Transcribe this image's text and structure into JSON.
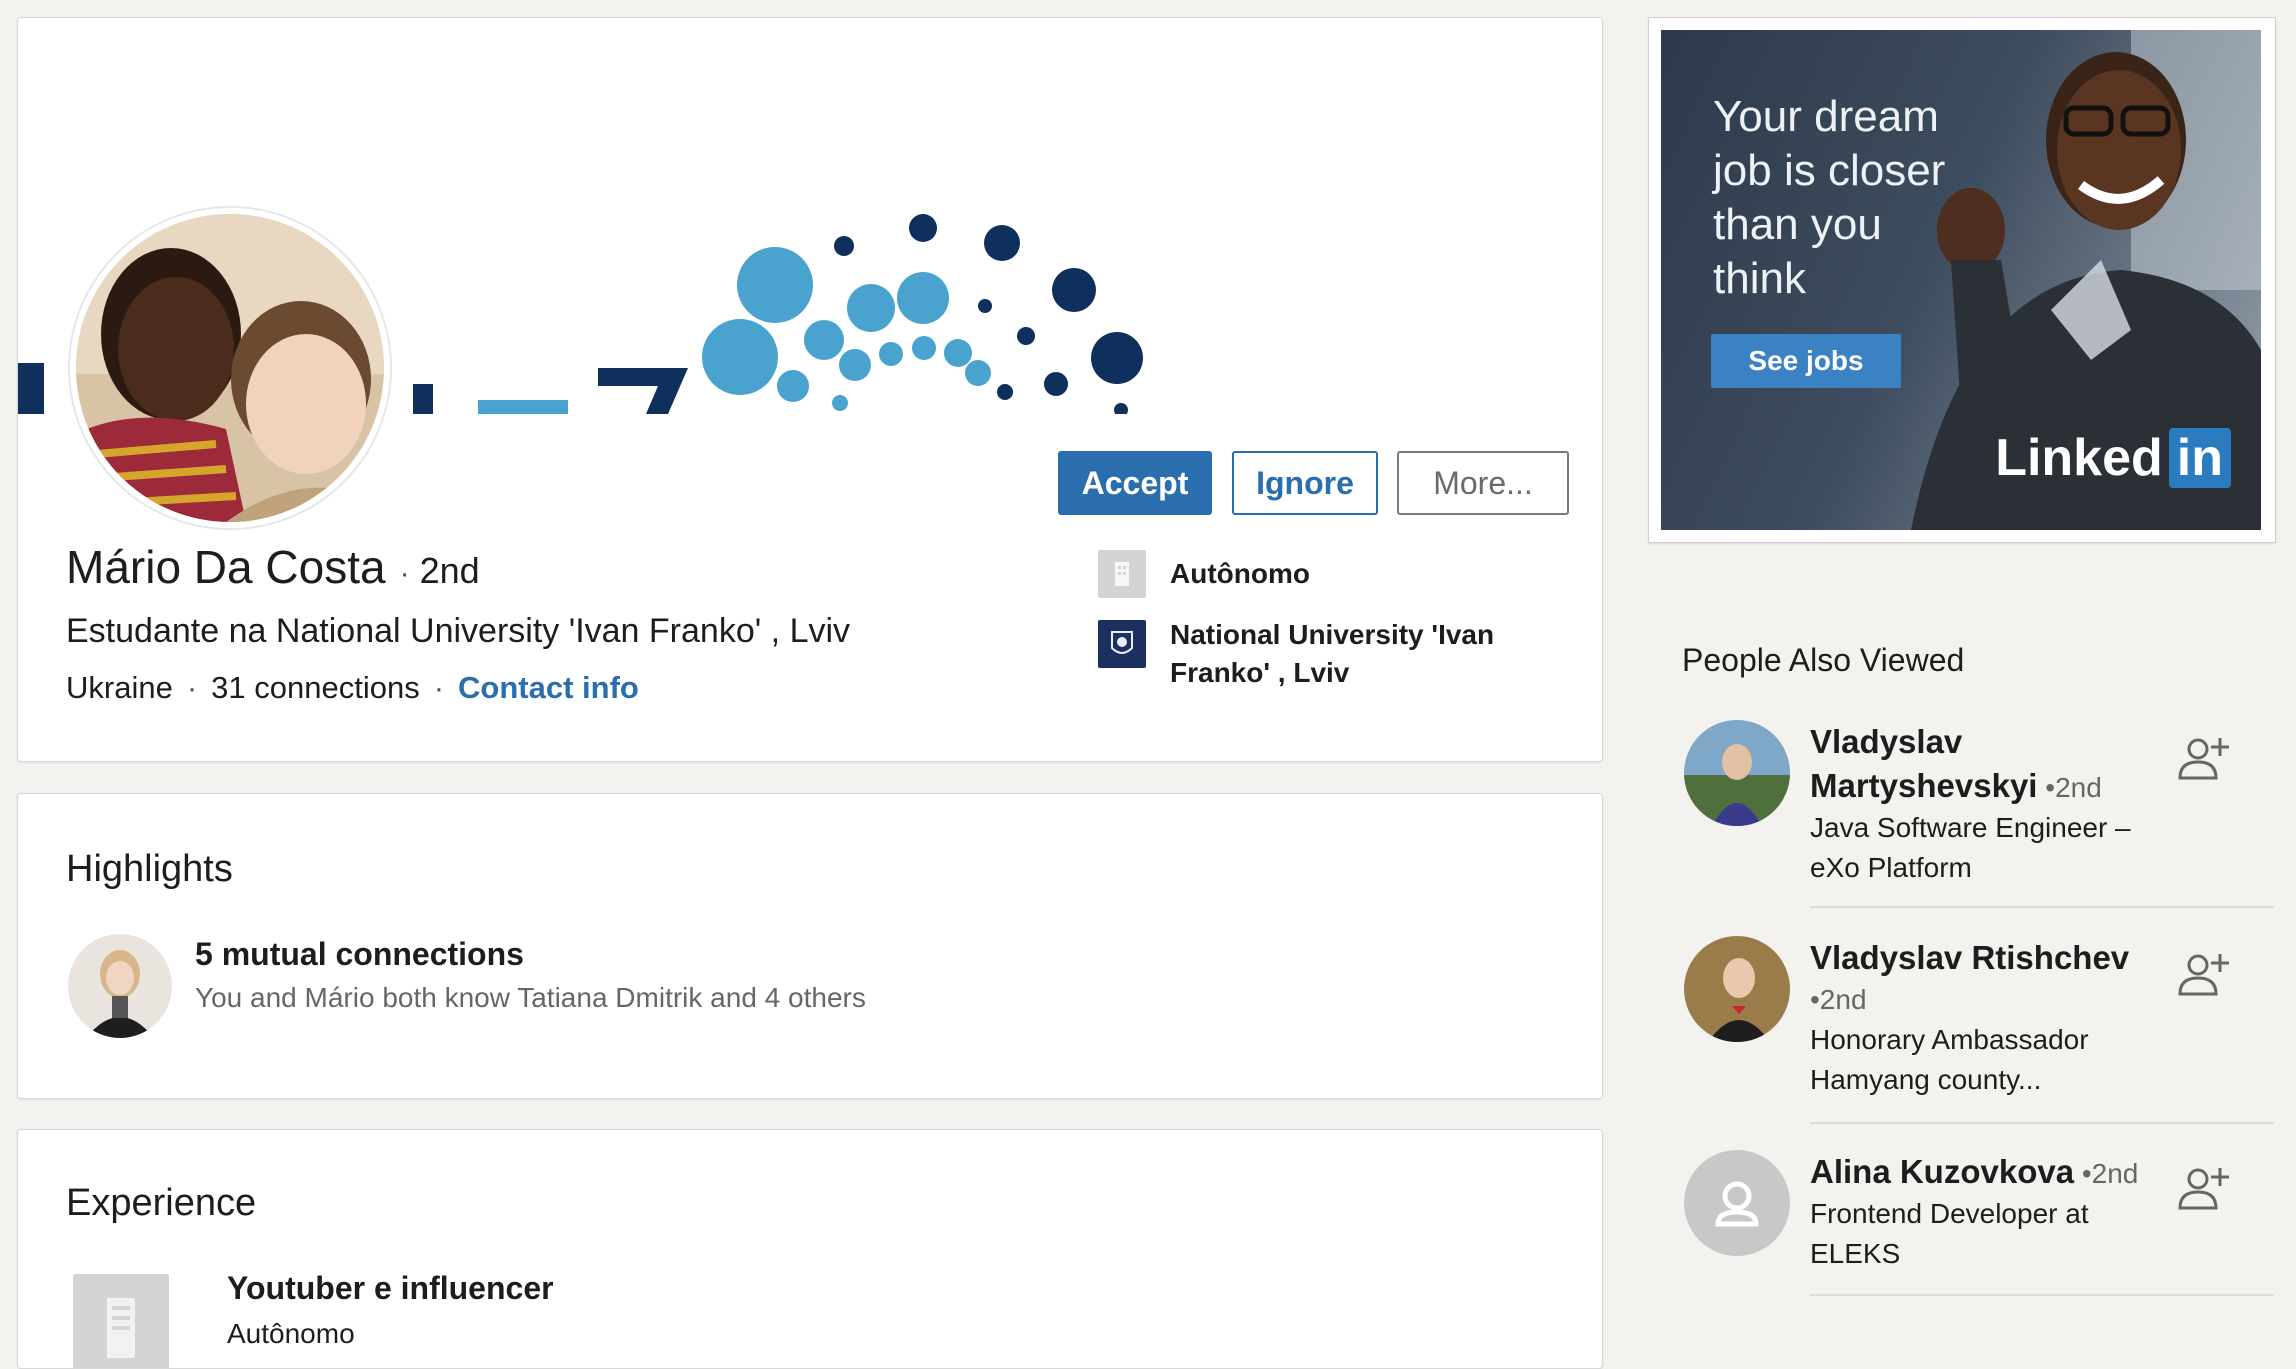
{
  "profile": {
    "name": "Mário Da Costa",
    "degree": "2nd",
    "headline": "Estudante na National University 'Ivan Franko' , Lviv",
    "location": "Ukraine",
    "connections": "31 connections",
    "contact_info": "Contact info",
    "current_company": "Autônomo",
    "education": "National University 'Ivan Franko' , Lviv"
  },
  "actions": {
    "accept": "Accept",
    "ignore": "Ignore",
    "more": "More..."
  },
  "highlights": {
    "title": "Highlights",
    "mutual_title": "5 mutual connections",
    "mutual_sub": "You and Mário both know Tatiana Dmitrik and 4 others"
  },
  "experience": {
    "title": "Experience",
    "job_title": "Youtuber e influencer",
    "company": "Autônomo"
  },
  "ad": {
    "headline": "Your dream job is closer than you think",
    "button": "See jobs",
    "logo_text": "Linked",
    "logo_in": "in"
  },
  "people_also_viewed": {
    "title": "People Also Viewed",
    "people": [
      {
        "name": "Vladyslav Martyshevskyi",
        "degree": "•2nd",
        "headline": "Java Software Engineer – eXo Platform"
      },
      {
        "name": "Vladyslav Rtishchev",
        "degree": "•2nd",
        "headline": "Honorary Ambassador Hamyang county..."
      },
      {
        "name": "Alina Kuzovkova",
        "degree": "•2nd",
        "headline": "Frontend Developer at ELEKS"
      }
    ]
  },
  "colors": {
    "accent": "#2a6ead",
    "page_background": "#f3f2ef",
    "banner_dot_light": "#4aa3cf",
    "banner_dot_dark": "#0f2f5c"
  }
}
